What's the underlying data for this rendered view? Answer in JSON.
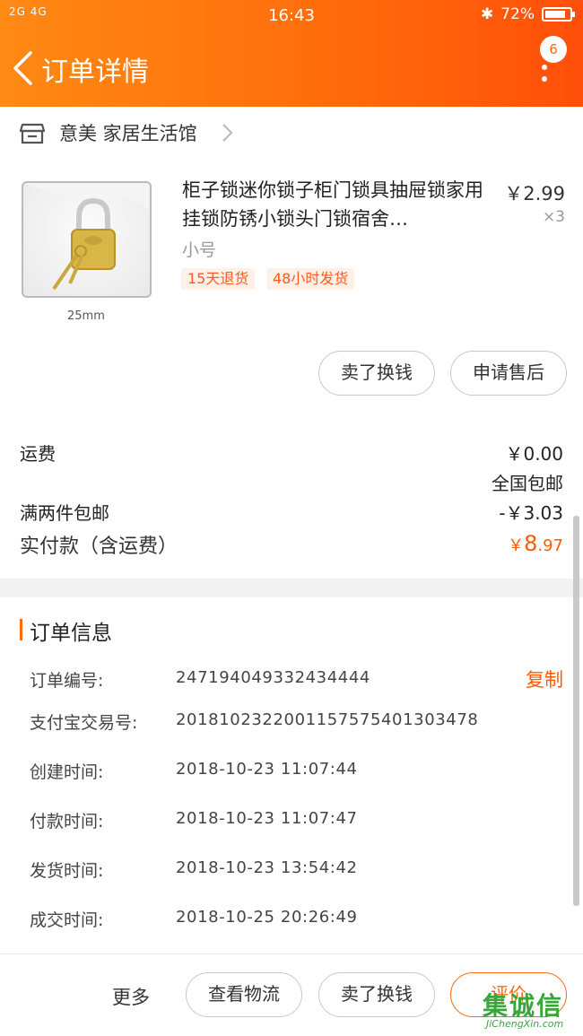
{
  "status_bar": {
    "signal": "2G 4G",
    "time": "16:43",
    "battery": "72%"
  },
  "header": {
    "title": "订单详情",
    "badge_count": "6"
  },
  "shop": {
    "name": "意美 家居生活馆"
  },
  "product": {
    "title": "柜子锁迷你锁子柜门锁具抽屉锁家用挂锁防锈小锁头门锁宿舍…",
    "price": "￥2.99",
    "quantity": "×3",
    "sku": "小号",
    "image_caption": "25mm",
    "tags": [
      "15天退货",
      "48小时发货"
    ],
    "actions": [
      "卖了换钱",
      "申请售后"
    ]
  },
  "fees": {
    "shipping_label": "运费",
    "shipping_value": "￥0.00",
    "shipping_note": "全国包邮",
    "discount_label": "满两件包邮",
    "discount_value": "-￥3.03",
    "paid_label": "实付款（含运费）",
    "paid_symbol": "￥",
    "paid_integer": "8",
    "paid_decimal": ".97"
  },
  "order_info": {
    "section_title": "订单信息",
    "copy_label": "复制",
    "rows": [
      {
        "label": "订单编号:",
        "value": "247194049332434444"
      },
      {
        "label": "支付宝交易号:",
        "value": "2018102322001157575401303478"
      },
      {
        "label": "创建时间:",
        "value": "2018-10-23 11:07:44"
      },
      {
        "label": "付款时间:",
        "value": "2018-10-23 11:07:47"
      },
      {
        "label": "发货时间:",
        "value": "2018-10-23 13:54:42"
      },
      {
        "label": "成交时间:",
        "value": "2018-10-25 20:26:49"
      }
    ]
  },
  "bottom_bar": {
    "more": "更多",
    "view_logistics": "查看物流",
    "sell": "卖了换钱",
    "review": "评价"
  },
  "watermark": {
    "main": "集诚信",
    "sub": "JiChengXin.com"
  },
  "colors": {
    "accent": "#ff6a0c",
    "price_orange": "#ff5a00",
    "tag_bg": "#fff0e8"
  }
}
